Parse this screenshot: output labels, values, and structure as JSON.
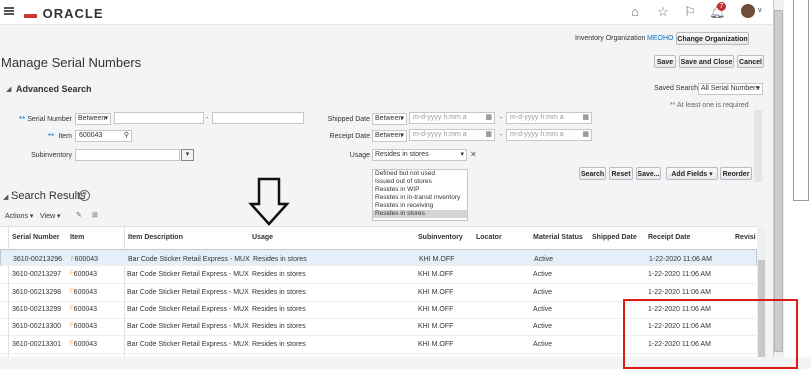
{
  "header": {
    "logo": "ORACLE",
    "notification_count": "7",
    "icons": [
      "hamburger-menu-icon",
      "home-icon",
      "star-icon",
      "flag-icon",
      "bell-icon",
      "user-avatar-icon"
    ],
    "avatar_caret": "v"
  },
  "page": {
    "title": "Manage Serial Numbers",
    "inventory_org_label": "Inventory Organization",
    "inventory_org_value": "MEOHO",
    "change_org_button": "Change Organization",
    "save_button": "Save",
    "save_close_button": "Save and Close",
    "cancel_button": "Cancel"
  },
  "advanced_search": {
    "title": "Advanced Search",
    "saved_search_label": "Saved Search",
    "saved_search_value": "All Serial Numbers",
    "required_note": "** At least one is required",
    "serial_number_label": "Serial Number",
    "serial_operator": "Between",
    "range_dash": "-",
    "item_label": "Item",
    "item_value": "600043",
    "subinventory_label": "Subinventory",
    "shipped_date_label": "Shipped Date",
    "shipped_operator": "Between",
    "receipt_date_label": "Receipt Date",
    "receipt_operator": "Between",
    "date_placeholder": "m-d-yyyy h:mm a",
    "usage_label": "Usage",
    "usage_value": "Resides in stores",
    "clear_symbol": "✕",
    "usage_options": [
      "Defined but not used",
      "Issued out of stores",
      "Resides in WIP",
      "Resides in in-transit inventory",
      "Resides in receiving",
      "Resides in stores"
    ],
    "search_button": "Search",
    "reset_button": "Reset",
    "save_search_button": "Save...",
    "add_fields_button": "Add Fields",
    "reorder_button": "Reorder"
  },
  "results": {
    "title": "Search Results",
    "actions_menu": "Actions",
    "view_menu": "View",
    "columns": [
      "Serial Number",
      "Item",
      "Item Description",
      "Usage",
      "Subinventory",
      "Locator",
      "Material Status",
      "Shipped Date",
      "Receipt Date",
      "Revisi"
    ],
    "rows": [
      {
        "serial": "3610-00213296",
        "item": "600043",
        "desc": "Bar Code Sticker Retail Express - MUX",
        "usage": "Resides in stores",
        "subinv": "KHI M.OFF",
        "status": "Active",
        "receipt": "1-22-2020 11:06 AM"
      },
      {
        "serial": "3610-00213297",
        "item": "600043",
        "desc": "Bar Code Sticker Retail Express - MUX",
        "usage": "Resides in stores",
        "subinv": "KHI M.OFF",
        "status": "Active",
        "receipt": "1-22-2020 11:06 AM"
      },
      {
        "serial": "3610-00213298",
        "item": "600043",
        "desc": "Bar Code Sticker Retail Express - MUX",
        "usage": "Resides in stores",
        "subinv": "KHI M.OFF",
        "status": "Active",
        "receipt": "1-22-2020 11:06 AM"
      },
      {
        "serial": "3610-00213299",
        "item": "600043",
        "desc": "Bar Code Sticker Retail Express - MUX",
        "usage": "Resides in stores",
        "subinv": "KHI M.OFF",
        "status": "Active",
        "receipt": "1-22-2020 11:06 AM"
      },
      {
        "serial": "3610-00213300",
        "item": "600043",
        "desc": "Bar Code Sticker Retail Express - MUX",
        "usage": "Resides in stores",
        "subinv": "KHI M.OFF",
        "status": "Active",
        "receipt": "1-22-2020 11:06 AM"
      },
      {
        "serial": "3610-00213301",
        "item": "600043",
        "desc": "Bar Code Sticker Retail Express - MUX",
        "usage": "Resides in stores",
        "subinv": "KHI M.OFF",
        "status": "Active",
        "receipt": "1-22-2020 11:06 AM"
      }
    ]
  },
  "colors": {
    "accent": "#0572ce",
    "logo_red": "#d0312d",
    "highlight_red": "#d91e18",
    "selected_row": "#e4eff9"
  }
}
